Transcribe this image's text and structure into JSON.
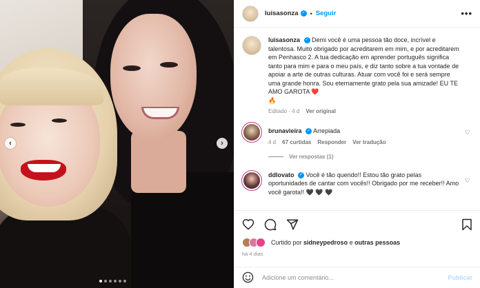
{
  "post": {
    "username": "luisasonza",
    "follow_label": "Seguir",
    "more_label": "•••"
  },
  "caption": {
    "username": "luisasonza",
    "text": "Demi você é uma pessoa tão doce, incrível e talentosa. Muito obrigado por acreditarem em mim, e por acreditarem em Penhasco 2. A tua dedicação em aprender português significa tanto para mim e para o meu país, e diz tanto sobre a tua vontade de apoiar a arte de outras culturas. Atuar com você foi e será sempre uma grande honra. Sou eternamente grato pela sua amizade! EU TE AMO GAROTA",
    "emoji": "❤️",
    "extra_emoji": "🔥",
    "edited_label": "Editado",
    "age": "4 d",
    "translation_label": "Ver original"
  },
  "comments": [
    {
      "username": "brunavieira",
      "text": "Arrepiada",
      "age": "4 d",
      "likes": "67 curtidas",
      "reply_label": "Responder",
      "translation_label": "Ver tradução",
      "view_replies": "Ver respostas (1)"
    },
    {
      "username": "ddlovato",
      "text": "Você é tão querido!! Estou tão grato pelas oportunidades de cantar com vocês!! Obrigado por me receber!! Amo você garota!! 🖤 🖤 🖤"
    }
  ],
  "likes": {
    "prefix": "Curtido por",
    "user": "sidneypedroso",
    "connector": "e",
    "others": "outras pessoas"
  },
  "timestamp": "há 4 dias",
  "add_comment": {
    "placeholder": "Adicione um comentário...",
    "publish_label": "Publicar"
  },
  "carousel": {
    "prev_label": "‹",
    "next_label": "›",
    "dots": 6,
    "active_dot": 0
  },
  "icons": {
    "verified": "verified-badge-icon",
    "heart": "heart-icon",
    "comment": "comment-icon",
    "share": "share-icon",
    "save": "bookmark-icon",
    "emoji": "emoji-icon"
  },
  "colors": {
    "accent": "#0095f6",
    "verified": "#0095f6",
    "muted": "#8e8e8e",
    "heart_red": "#ed4956"
  }
}
